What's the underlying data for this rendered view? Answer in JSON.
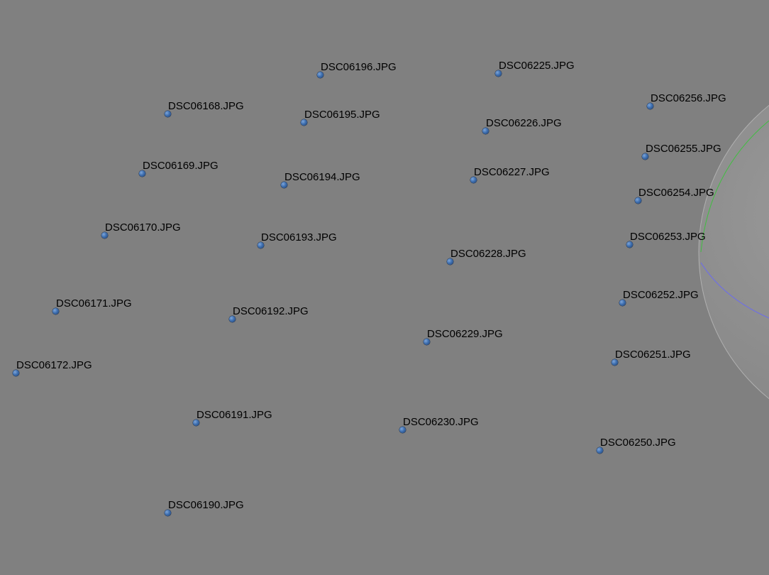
{
  "viewport": {
    "background": "#808080",
    "sphere_fill": "#8a8a8a",
    "equator_color": "#6a6af0",
    "meridian_color": "#3fbf3f"
  },
  "cameras": [
    {
      "label": "DSC06196.JPG"
    },
    {
      "label": "DSC06225.JPG"
    },
    {
      "label": "DSC06168.JPG"
    },
    {
      "label": "DSC06195.JPG"
    },
    {
      "label": "DSC06226.JPG"
    },
    {
      "label": "DSC06256.JPG"
    },
    {
      "label": "DSC06255.JPG"
    },
    {
      "label": "DSC06169.JPG"
    },
    {
      "label": "DSC06194.JPG"
    },
    {
      "label": "DSC06227.JPG"
    },
    {
      "label": "DSC06254.JPG"
    },
    {
      "label": "DSC06170.JPG"
    },
    {
      "label": "DSC06193.JPG"
    },
    {
      "label": "DSC06253.JPG"
    },
    {
      "label": "DSC06228.JPG"
    },
    {
      "label": "DSC06171.JPG"
    },
    {
      "label": "DSC06192.JPG"
    },
    {
      "label": "DSC06252.JPG"
    },
    {
      "label": "DSC06229.JPG"
    },
    {
      "label": "DSC06251.JPG"
    },
    {
      "label": "DSC06172.JPG"
    },
    {
      "label": "DSC06191.JPG"
    },
    {
      "label": "DSC06230.JPG"
    },
    {
      "label": "DSC06250.JPG"
    },
    {
      "label": "DSC06190.JPG"
    }
  ]
}
